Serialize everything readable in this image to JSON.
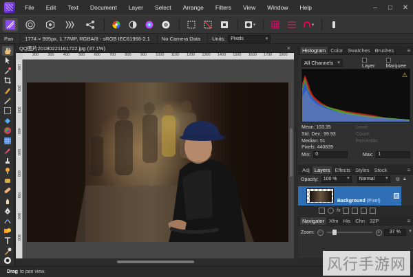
{
  "menubar": {
    "items": [
      "File",
      "Edit",
      "Text",
      "Document",
      "Layer",
      "Select",
      "Arrange",
      "Filters",
      "View",
      "Window",
      "Help"
    ]
  },
  "context": {
    "tool_name": "Pan",
    "image_info": "1774 × 995px, 1.77MP, RGBA/8 - sRGB IEC61966-2.1",
    "camera": "No Camera Data",
    "units_label": "Units:",
    "units_value": "Pixels"
  },
  "document": {
    "tab_title": "QQ图片20180221161722.jpg (37.1%)",
    "ruler_h": [
      "200",
      "300",
      "400",
      "500",
      "600",
      "700",
      "800",
      "900",
      "1000",
      "1100",
      "1200",
      "1300",
      "1400",
      "1500",
      "1600",
      "1700",
      "1800"
    ],
    "ruler_v": [
      "100",
      "200",
      "300",
      "400",
      "500",
      "600",
      "700",
      "800",
      "900"
    ]
  },
  "histogram_panel": {
    "tabs": [
      "Histogram",
      "Color",
      "Swatches",
      "Brushes"
    ],
    "channels": "All Channels",
    "layer_label": "Layer",
    "marquee_label": "Marquee",
    "stats": [
      "Mean: 103.35",
      "Std. Dev.: 99.93",
      "Median: 51",
      "Pixels: 440839"
    ],
    "stats_dim": [
      "Level:",
      "Count:",
      "Percentile:"
    ],
    "min_label": "Min:",
    "min_value": "0",
    "max_label": "Max:",
    "max_value": "1",
    "warning_icon": "warning-icon"
  },
  "layers_panel": {
    "tabs": [
      "Adj",
      "Layers",
      "Effects",
      "Styles",
      "Stock"
    ],
    "opacity_label": "Opacity:",
    "opacity_value": "100 %",
    "blend_mode": "Normal",
    "layer_name": "Background",
    "layer_type": "(Pixel)"
  },
  "navigator_panel": {
    "tabs": [
      "Navigator",
      "Xfm",
      "His",
      "Chn",
      "32P"
    ],
    "zoom_label": "Zoom:",
    "zoom_value": "37 %"
  },
  "status": {
    "bold": "Drag",
    "text": "to pan view."
  },
  "watermark": "风行手游网",
  "colors": {
    "accent": "#2f6fb5",
    "hist_red": "#e02020",
    "hist_green": "#22c32a",
    "hist_blue": "#2b4cf0",
    "warning": "#f2c81a"
  }
}
